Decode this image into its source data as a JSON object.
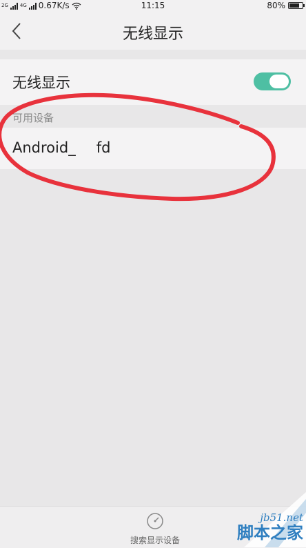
{
  "status_bar": {
    "network_label": "2G",
    "network_label_2": "4G",
    "speed": "0.67K/s",
    "time": "11:15",
    "battery_percent": "80%",
    "battery_level": 0.8
  },
  "header": {
    "title": "无线显示",
    "back_icon": "chevron-left-icon"
  },
  "wireless_display": {
    "label": "无线显示",
    "enabled": true,
    "toggle_color": "#4ebfa3"
  },
  "available_devices": {
    "section_title": "可用设备",
    "devices": [
      {
        "name": "Android_",
        "name_suffix": "fd"
      }
    ]
  },
  "bottom_bar": {
    "search_label": "搜索显示设备",
    "search_icon": "radar-icon"
  },
  "annotation": {
    "color": "#e8323c"
  },
  "watermark": {
    "url": "jb51.net",
    "text": "脚本之家",
    "color": "#2f7fc0"
  }
}
